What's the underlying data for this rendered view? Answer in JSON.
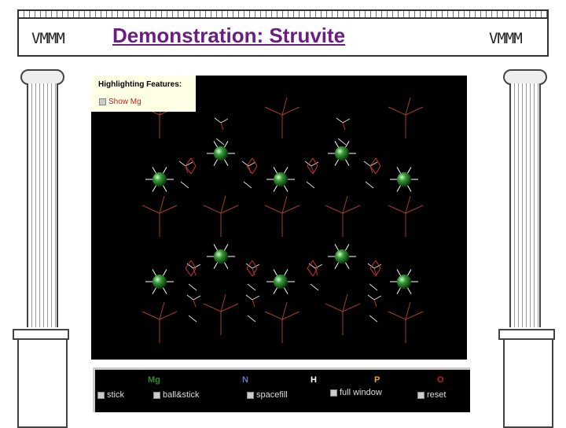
{
  "header": {
    "title": "Demonstration: Struvite",
    "left_logo": "VMMM",
    "right_logo": "VMMM"
  },
  "viewer": {
    "panel_title": "Highlighting Features:",
    "show_option": "Show Mg"
  },
  "controls": {
    "elements": [
      {
        "label": "Mg",
        "color": "#2e8b2e"
      },
      {
        "label": "N",
        "color": "#7070d0"
      },
      {
        "label": "H",
        "color": "#ffffff"
      },
      {
        "label": "P",
        "color": "#e8a040"
      },
      {
        "label": "O",
        "color": "#c02020"
      }
    ],
    "options": [
      "stick",
      "ball&stick",
      "spacefill",
      "full window",
      "reset"
    ]
  }
}
